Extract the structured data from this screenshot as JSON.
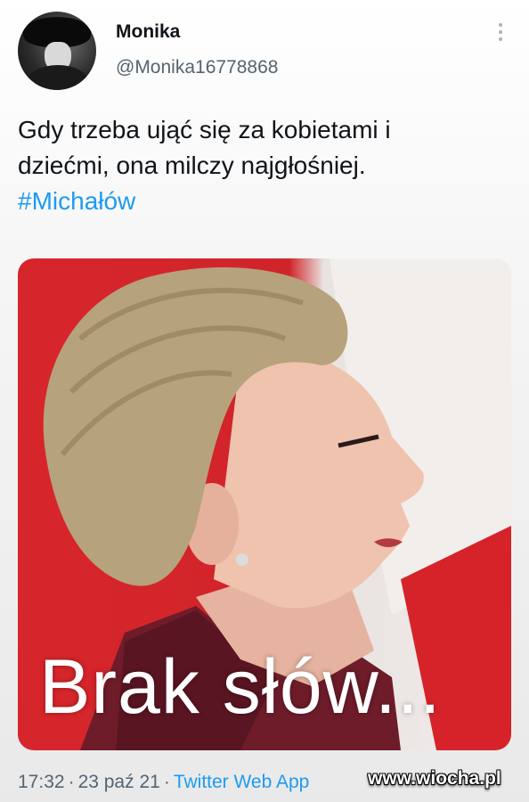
{
  "user": {
    "display_name": "Monika",
    "handle": "@Monika16778868"
  },
  "tweet": {
    "text_line1": "Gdy trzeba ująć się za kobietami i",
    "text_line2": "dziećmi, ona milczy najgłośniej.",
    "hashtag": "#Michałów",
    "media_caption": "Brak słów..."
  },
  "meta": {
    "time": "17:32",
    "date": "23 paź 21",
    "separator": "·",
    "source": "Twitter Web App"
  },
  "watermark": "www.wiocha.pl",
  "icons": {
    "more": "more-vertical-icon"
  },
  "colors": {
    "link": "#1d9bf0",
    "muted": "#536471",
    "flag_red": "#d7262b"
  }
}
